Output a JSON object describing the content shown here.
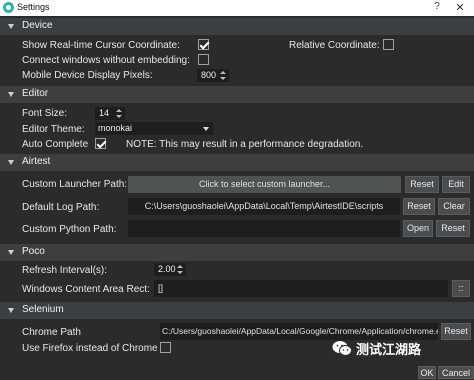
{
  "window": {
    "title": "Settings",
    "help_glyph": "?",
    "close_glyph": "✕"
  },
  "sections": {
    "device": {
      "header": "Device",
      "cursor_label": "Show Real-time Cursor Coordinate:",
      "cursor_checked": true,
      "relative_label": "Relative Coordinate:",
      "relative_checked": false,
      "connect_label": "Connect windows without embedding:",
      "connect_checked": false,
      "mobile_pixels_label": "Mobile Device Display Pixels:",
      "mobile_pixels_value": "800"
    },
    "editor": {
      "header": "Editor",
      "font_size_label": "Font Size:",
      "font_size_value": "14",
      "theme_label": "Editor Theme:",
      "theme_value": "monokai",
      "autocomplete_label": "Auto Complete",
      "autocomplete_checked": true,
      "note": "NOTE: This may result in a performance degradation."
    },
    "airtest": {
      "header": "Airtest",
      "launcher_label": "Custom Launcher Path:",
      "launcher_value": "Click to select custom launcher...",
      "launcher_reset": "Reset",
      "launcher_edit": "Edit",
      "log_label": "Default Log Path:",
      "log_value": "C:\\Users\\guoshaolei\\AppData\\Local\\Temp\\AirtestIDE\\scripts",
      "log_reset": "Reset",
      "log_clear": "Clear",
      "python_label": "Custom Python Path:",
      "python_value": "",
      "python_open": "Open",
      "python_reset": "Reset"
    },
    "poco": {
      "header": "Poco",
      "refresh_label": "Refresh Interval(s):",
      "refresh_value": "2.00",
      "rect_label": "Windows Content Area Rect:",
      "rect_value": "[]",
      "rect_button": "::"
    },
    "selenium": {
      "header": "Selenium",
      "chrome_label": "Chrome Path",
      "chrome_value": "C:/Users/guoshaolei/AppData/Local/Google/Chrome/Application/chrome.exe",
      "chrome_reset": "Reset",
      "firefox_label": "Use Firefox instead of Chrome",
      "firefox_checked": false
    }
  },
  "footer": {
    "ok": "OK",
    "cancel": "Cancel"
  },
  "watermark": {
    "text": "测试江湖路",
    "icon": "wechat-icon"
  },
  "colors": {
    "background": "#2b2b2b",
    "header": "#3c3f41",
    "field": "#1e1e1e",
    "button": "#4a4d4f",
    "title_icon": "#2fb0a4"
  }
}
